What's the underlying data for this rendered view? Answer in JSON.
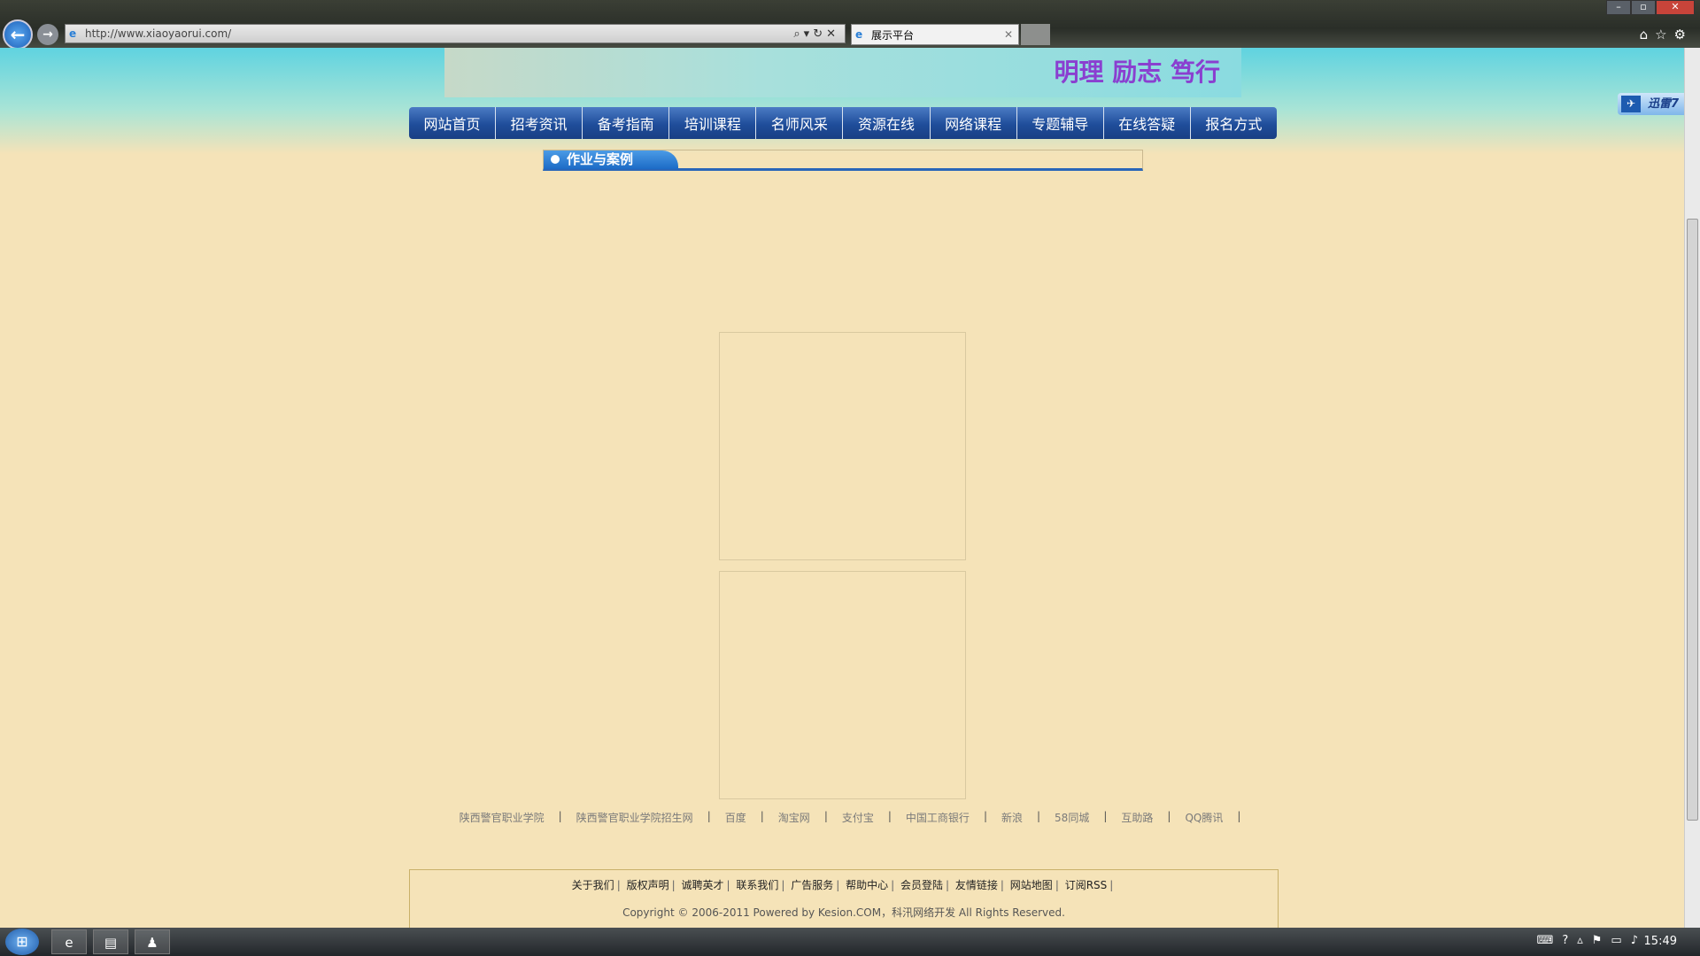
{
  "browser": {
    "url": "http://www.xiaoyaorui.com/",
    "tab_title": "展示平台",
    "addr_tools": "⌕▾↻✕",
    "right_tools": "⌂☆⚙"
  },
  "header": {
    "slogan": "明理 励志 笃行"
  },
  "nav": [
    "网站首页",
    "招考资讯",
    "备考指南",
    "培训课程",
    "名师风采",
    "资源在线",
    "网络课程",
    "专题辅导",
    "在线答疑",
    "报名方式"
  ],
  "section": {
    "title": "作业与案例"
  },
  "friend_links": [
    "陕西警官职业学院",
    "陕西警官职业学院招生网",
    "百度",
    "淘宝网",
    "支付宝",
    "中国工商银行",
    "新浪",
    "58同城",
    "互助路",
    "QQ腾讯"
  ],
  "footer": {
    "links": [
      "关于我们",
      "版权声明",
      "诚聘英才",
      "联系我们",
      "广告服务",
      "帮助中心",
      "会员登陆",
      "友情链接",
      "网站地图",
      "订阅RSS"
    ],
    "copyright": "Copyright © 2006-2011 Powered by Kesion.COM，科汛网络开发  All Rights Reserved."
  },
  "xunlei": {
    "label": "迅雷7"
  },
  "taskbar": {
    "clock": "15:49"
  }
}
